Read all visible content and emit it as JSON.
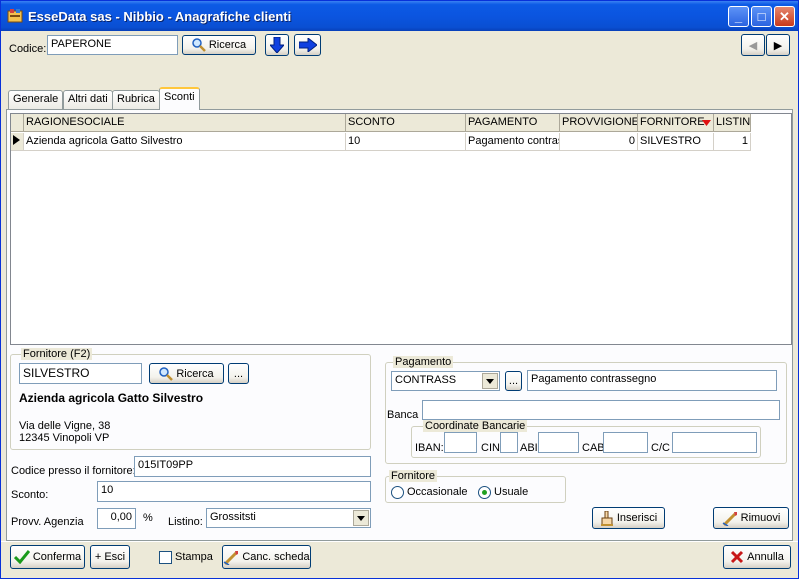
{
  "window": {
    "title": "EsseData sas - Nibbio - Anagrafiche clienti",
    "minimize": "_",
    "maximize": "□",
    "close": "✕"
  },
  "toolbar": {
    "codice_label": "Codice:",
    "codice_value": "PAPERONE",
    "ricerca_label": "Ricerca",
    "nav_prev": "◀",
    "nav_next": "▶"
  },
  "tabs": [
    {
      "label": "Generale",
      "active": false
    },
    {
      "label": "Altri dati",
      "active": false
    },
    {
      "label": "Rubrica",
      "active": false
    },
    {
      "label": "Sconti",
      "active": true
    }
  ],
  "grid": {
    "columns": [
      "RAGIONESOCIALE",
      "SCONTO",
      "PAGAMENTO",
      "PROVVIGIONE",
      "FORNITORE",
      "LISTIN"
    ],
    "rows": [
      [
        "Azienda agricola Gatto Silvestro",
        "10",
        "Pagamento contrassegno",
        "0",
        "SILVESTRO",
        "1"
      ]
    ]
  },
  "fornitore": {
    "group_title": "Fornitore (F2)",
    "code": "SILVESTRO",
    "ricerca_label": "Ricerca",
    "ellipsis": "...",
    "name": "Azienda agricola Gatto Silvestro",
    "address1": "Via delle Vigne, 38",
    "address2": "12345 Vinopoli VP"
  },
  "form": {
    "codice_presso_label": "Codice presso il fornitore:",
    "codice_presso_value": "015IT09PP",
    "sconto_label": "Sconto:",
    "sconto_value": "10",
    "provv_label": "Provv. Agenzia",
    "provv_value": "0,00",
    "percent": "%",
    "listino_label": "Listino:",
    "listino_value": "Grossitsti"
  },
  "pagamento": {
    "group_title": "Pagamento",
    "code": "CONTRASS",
    "ellipsis": "...",
    "description": "Pagamento contrassegno",
    "banca_label": "Banca",
    "banca_value": "",
    "coord_title": "Coordinate Bancarie",
    "iban_label": "IBAN:",
    "cin_label": "CIN",
    "abi_label": "ABI",
    "cab_label": "CAB",
    "cc_label": "C/C"
  },
  "fornitore_type": {
    "group_title": "Fornitore",
    "occasionale": "Occasionale",
    "usuale": "Usuale",
    "selected": "usuale"
  },
  "actions": {
    "inserisci": "Inserisci",
    "rimuovi": "Rimuovi"
  },
  "bottom": {
    "conferma": "Conferma",
    "esci": "+ Esci",
    "stampa": "Stampa",
    "canc_scheda": "Canc. scheda",
    "annulla": "Annulla"
  },
  "colors": {
    "titlebar": "#0b55e0",
    "accent_tab": "#ffc73c",
    "sort_arrow": "#e01010",
    "nav_arrow": "#1040e0",
    "confirm_green": "#1a9a1a",
    "cancel_red": "#c81818"
  }
}
